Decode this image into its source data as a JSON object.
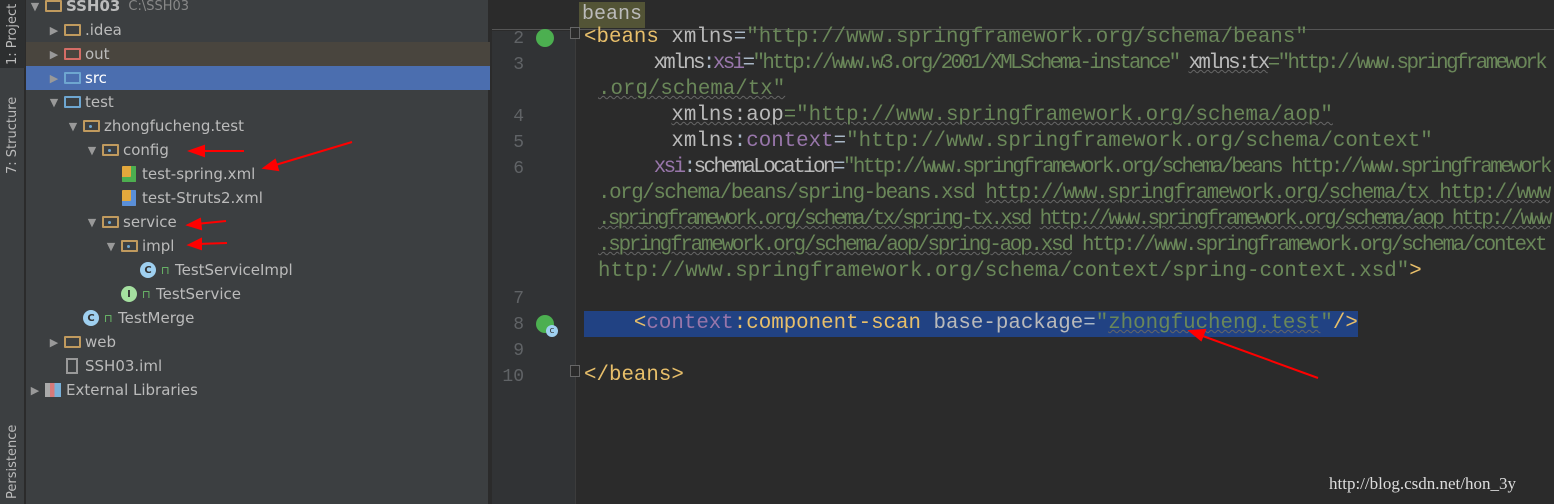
{
  "tool_windows": {
    "project": "1: Project",
    "structure": "7: Structure",
    "persistence": "Persistence"
  },
  "project_path": "C:\\SSH03",
  "tree": [
    {
      "label": "SSH03",
      "level": 0,
      "expanded": true,
      "icon": "module-folder-icon",
      "bold": true
    },
    {
      "label": ".idea",
      "level": 1,
      "expanded": false,
      "icon": "folder-icon"
    },
    {
      "label": "out",
      "level": 1,
      "expanded": false,
      "icon": "excluded-folder-icon",
      "state": "out"
    },
    {
      "label": "src",
      "level": 1,
      "expanded": false,
      "icon": "source-folder-icon",
      "state": "selected"
    },
    {
      "label": "test",
      "level": 1,
      "expanded": true,
      "icon": "test-folder-icon"
    },
    {
      "label": "zhongfucheng.test",
      "level": 2,
      "expanded": true,
      "icon": "package-icon"
    },
    {
      "label": "config",
      "level": 3,
      "expanded": true,
      "icon": "package-icon"
    },
    {
      "label": "test-spring.xml",
      "level": 4,
      "leaf": true,
      "icon": "spring-xml-icon"
    },
    {
      "label": "test-Struts2.xml",
      "level": 4,
      "leaf": true,
      "icon": "struts-xml-icon"
    },
    {
      "label": "service",
      "level": 3,
      "expanded": true,
      "icon": "package-icon"
    },
    {
      "label": "impl",
      "level": 4,
      "expanded": true,
      "icon": "package-icon"
    },
    {
      "label": "TestServiceImpl",
      "level": 5,
      "leaf": true,
      "icon": "class-icon",
      "lock": true
    },
    {
      "label": "TestService",
      "level": 4,
      "leaf": true,
      "icon": "interface-icon",
      "lock": true
    },
    {
      "label": "TestMerge",
      "level": 2,
      "leaf": true,
      "icon": "test-class-icon",
      "lock": true
    },
    {
      "label": "web",
      "level": 1,
      "expanded": false,
      "icon": "web-folder-icon"
    },
    {
      "label": "SSH03.iml",
      "level": 1,
      "leaf": true,
      "icon": "iml-file-icon"
    },
    {
      "label": "External Libraries",
      "level": 0,
      "expanded": false,
      "icon": "libraries-icon"
    }
  ],
  "breadcrumb": "beans",
  "code_rows": [
    {
      "line": "2",
      "gutter": "spring-bean-icon",
      "fold": true,
      "tokens": [
        [
          "tag",
          "<beans "
        ],
        [
          "attr",
          "xmlns"
        ],
        [
          "plain",
          "="
        ],
        [
          "val",
          "\"http://www.springframework.org/schema/beans\""
        ]
      ]
    },
    {
      "line": "3",
      "tokens": [
        [
          "plain",
          "       "
        ],
        [
          "attr",
          "xmlns"
        ],
        [
          "plain",
          ":"
        ],
        [
          "ns",
          "xsi"
        ],
        [
          "plain",
          "="
        ],
        [
          "val",
          "\"http://www.w3.org/2001/XMLSchema-instance\""
        ],
        [
          "plain",
          " "
        ],
        [
          "attr u",
          "xmlns:tx"
        ],
        [
          "val",
          "=\"http://www.springframework"
        ]
      ]
    },
    {
      "line": "",
      "cont": true,
      "tokens": [
        [
          "val u",
          ".org/schema/tx\""
        ]
      ]
    },
    {
      "line": "4",
      "tokens": [
        [
          "plain",
          "       "
        ],
        [
          "attr u",
          "xmlns:aop"
        ],
        [
          "val u",
          "=\"http://www.springframework.org/schema/aop\""
        ]
      ]
    },
    {
      "line": "5",
      "tokens": [
        [
          "plain",
          "       "
        ],
        [
          "attr",
          "xmlns"
        ],
        [
          "plain",
          ":"
        ],
        [
          "ns",
          "context"
        ],
        [
          "plain",
          "="
        ],
        [
          "val",
          "\"http://www.springframework.org/schema/context\""
        ]
      ]
    },
    {
      "line": "6",
      "tokens": [
        [
          "plain",
          "       "
        ],
        [
          "ns",
          "xsi"
        ],
        [
          "plain",
          ":"
        ],
        [
          "attr",
          "schemaLocation"
        ],
        [
          "plain",
          "="
        ],
        [
          "val",
          "\"http://www.springframework.org/schema/beans http://www.springframework"
        ]
      ]
    },
    {
      "line": "",
      "cont": true,
      "tokens": [
        [
          "val",
          ".org/schema/beans/spring-beans.xsd "
        ],
        [
          "val u",
          "http://www.springframework.org/schema/tx http://www"
        ]
      ]
    },
    {
      "line": "",
      "cont": true,
      "tokens": [
        [
          "val u",
          ".springframework.org/schema/tx/spring-tx.xsd"
        ],
        [
          "val",
          " "
        ],
        [
          "val u",
          "http://www.springframework.org/schema/aop http://www"
        ]
      ]
    },
    {
      "line": "",
      "cont": true,
      "tokens": [
        [
          "val u",
          ".springframework.org/schema/aop/spring-aop.xsd"
        ],
        [
          "val",
          " http://www.springframework.org/schema/context"
        ]
      ]
    },
    {
      "line": "",
      "cont": true,
      "tokens": [
        [
          "val",
          "http://www.springframework.org/schema/context/spring-context.xsd\""
        ],
        [
          "tag",
          ">"
        ]
      ]
    },
    {
      "line": "7",
      "tokens": []
    },
    {
      "line": "8",
      "gutter": "spring-component-icon",
      "highlight": true,
      "tokens": [
        [
          "plain",
          "    "
        ],
        [
          "tag",
          "<"
        ],
        [
          "ns",
          "context"
        ],
        [
          "tag",
          ":component-scan "
        ],
        [
          "attr",
          "base-package"
        ],
        [
          "plain",
          "="
        ],
        [
          "val",
          "\""
        ],
        [
          "val u",
          "zhongfucheng.test"
        ],
        [
          "val",
          "\""
        ],
        [
          "tag",
          "/>"
        ]
      ]
    },
    {
      "line": "9",
      "tokens": []
    },
    {
      "line": "10",
      "fold": true,
      "tokens": [
        [
          "tag",
          "</beans>"
        ]
      ]
    }
  ],
  "watermark": "http://blog.csdn.net/hon_3y",
  "colors": {
    "annotation_arrows": "#ff0000",
    "selection": "#4b6eaf",
    "line_highlight": "#214283"
  }
}
